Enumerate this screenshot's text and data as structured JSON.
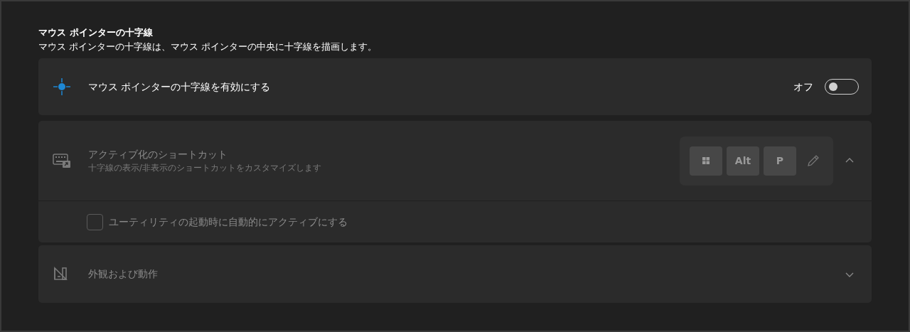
{
  "section": {
    "title": "マウス ポインターの十字線",
    "description": "マウス ポインターの十字線は、マウス ポインターの中央に十字線を描画します。"
  },
  "enable": {
    "label": "マウス ポインターの十字線を有効にする",
    "state_label": "オフ",
    "on": false
  },
  "shortcut": {
    "title": "アクティブ化のショートカット",
    "description": "十字線の表示/非表示のショートカットをカスタマイズします",
    "disabled": true,
    "expanded": true,
    "keys": [
      {
        "kind": "windows"
      },
      {
        "kind": "text",
        "label": "Alt"
      },
      {
        "kind": "text",
        "label": "P"
      }
    ],
    "auto_activate": {
      "label": "ユーティリティの起動時に自動的にアクティブにする",
      "checked": false,
      "disabled": true
    }
  },
  "appearance": {
    "title": "外観および動作",
    "disabled": true,
    "expanded": false
  }
}
